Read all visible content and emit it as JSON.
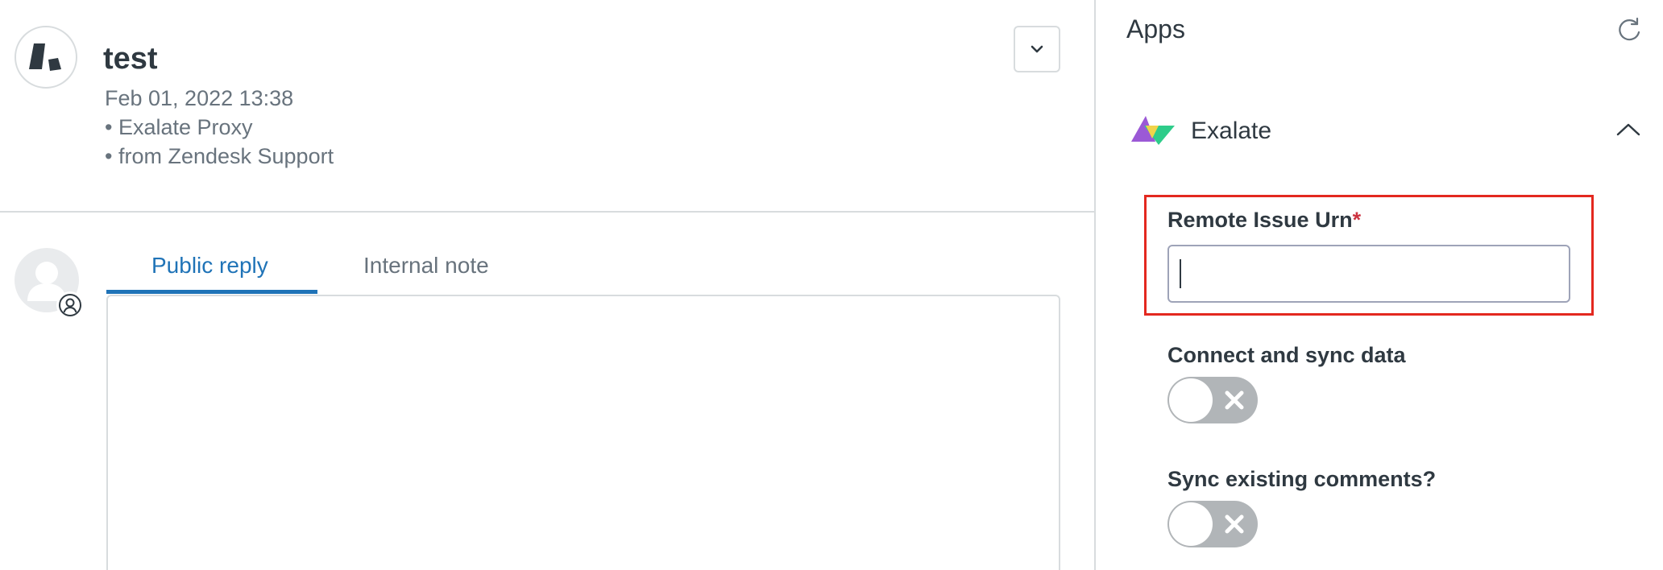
{
  "ticket": {
    "title": "test",
    "date": "Feb 01, 2022 13:38",
    "meta_lines": [
      "• Exalate Proxy",
      "• from Zendesk Support"
    ]
  },
  "composer": {
    "tabs": [
      {
        "label": "Public reply",
        "active": true
      },
      {
        "label": "Internal note",
        "active": false
      }
    ],
    "active_color": "#1f73b7"
  },
  "apps": {
    "title": "Apps",
    "app": {
      "name": "Exalate",
      "fields": [
        {
          "label": "Remote Issue Urn",
          "required": true,
          "required_mark": "*",
          "value": "",
          "placeholder": ""
        },
        {
          "label": "Connect and sync data",
          "type": "toggle",
          "on": false
        },
        {
          "label": "Sync existing comments?",
          "type": "toggle",
          "on": false
        }
      ]
    }
  },
  "icons": {
    "brand_logo": "zendesk-logo-icon",
    "options": "chevron-down-icon",
    "user_avatar": "user-silhouette-icon",
    "user_badge": "user-circle-icon",
    "refresh": "refresh-icon",
    "app_logo": "exalate-logo-icon",
    "collapse": "chevron-up-icon",
    "toggle_off": "x-icon"
  },
  "colors": {
    "highlight": "#e3281f",
    "required": "#cc3340",
    "toggle_off": "#b1b5b8"
  }
}
